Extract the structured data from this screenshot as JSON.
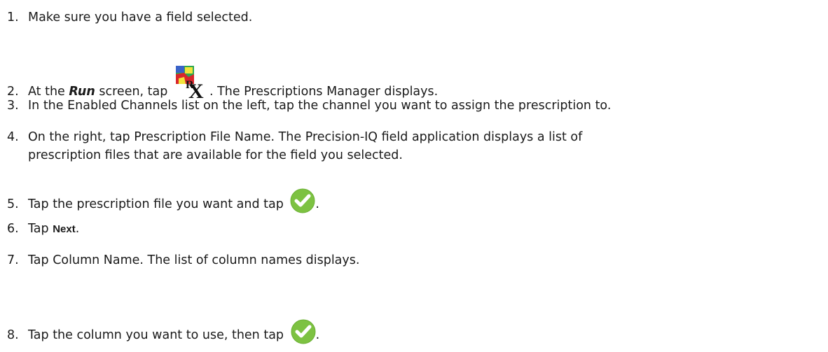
{
  "steps": [
    {
      "num": "1.",
      "text": "Make sure you have a field selected."
    },
    {
      "num": "2.",
      "before": "At the ",
      "emphasis": "Run",
      "middle": " screen, tap ",
      "after": ". The Prescriptions Manager displays.",
      "icon": "prescription-rx-icon"
    },
    {
      "num": "3.",
      "text": "In the Enabled Channels list on the left, tap the channel you want to assign the prescription to."
    },
    {
      "num": "4.",
      "line1": "On the right, tap Prescription File Name. The Precision-IQ field application displays a list of",
      "line2": "prescription files that are available for the field you selected."
    },
    {
      "num": "5.",
      "before": "Tap the prescription file you want and tap ",
      "after": ".",
      "icon": "green-check-icon"
    },
    {
      "num": "6.",
      "before": "Tap ",
      "emphasis": "Next",
      "after": "."
    },
    {
      "num": "7.",
      "text": "Tap Column Name. The list of column names displays."
    },
    {
      "num": "8.",
      "before": "Tap the column you want to use, then tap ",
      "after": ".",
      "icon": "green-check-icon"
    }
  ],
  "colors": {
    "text": "#1a1a1a",
    "check_green": "#7dc242",
    "rx_red": "#d9262c",
    "rx_green": "#2fa84f",
    "rx_yellow": "#f2e33a",
    "rx_blue": "#3a63c8"
  }
}
